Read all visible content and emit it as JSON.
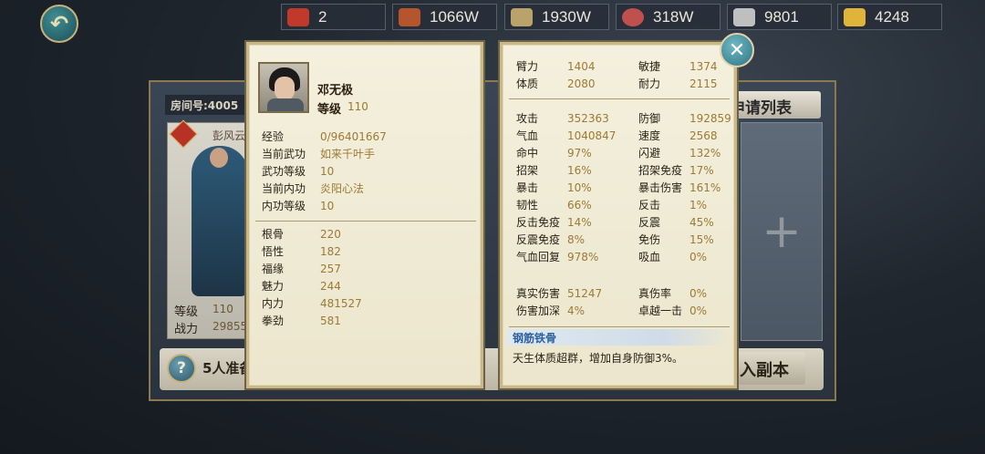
{
  "top_bar": {
    "back_icon": "back-arrow-icon",
    "resources": [
      {
        "icon": "token-icon",
        "value": "2",
        "color": "#c0392b"
      },
      {
        "icon": "wood-icon",
        "value": "1066W",
        "color": "#b5552e"
      },
      {
        "icon": "cloth-icon",
        "value": "1930W",
        "color": "#b9a36a"
      },
      {
        "icon": "ore-icon",
        "value": "318W",
        "color": "#c0504d"
      },
      {
        "icon": "silver-icon",
        "value": "9801",
        "color": "#bfbfbf"
      },
      {
        "icon": "gold-ingot-icon",
        "value": "4248",
        "color": "#e0b43a"
      }
    ]
  },
  "room": {
    "room_number": "房间号:4005",
    "apply_list": "申请列表",
    "player_name": "彭风云",
    "level_label": "等级",
    "level_value": "110",
    "power_label": "战力",
    "power_value": "29855",
    "ready_text": "5人准备",
    "enter_button": "入副本",
    "add_icon": "+"
  },
  "hero": {
    "name": "邓无极",
    "level_label": "等级",
    "level": "110",
    "info": [
      {
        "label": "经验",
        "value": "0/96401667"
      },
      {
        "label": "当前武功",
        "value": "如来千叶手"
      },
      {
        "label": "武功等级",
        "value": "10"
      },
      {
        "label": "当前内功",
        "value": "炎阳心法"
      },
      {
        "label": "内功等级",
        "value": "10"
      }
    ],
    "attrs": [
      {
        "label": "根骨",
        "value": "220"
      },
      {
        "label": "悟性",
        "value": "182"
      },
      {
        "label": "福缘",
        "value": "257"
      },
      {
        "label": "魅力",
        "value": "244"
      },
      {
        "label": "内力",
        "value": "481527"
      },
      {
        "label": "拳劲",
        "value": "581"
      }
    ]
  },
  "stats": {
    "base": [
      {
        "l1": "臂力",
        "v1": "1404",
        "l2": "敏捷",
        "v2": "1374"
      },
      {
        "l1": "体质",
        "v1": "2080",
        "l2": "耐力",
        "v2": "2115"
      }
    ],
    "combat": [
      {
        "l1": "攻击",
        "v1": "352363",
        "l2": "防御",
        "v2": "192859"
      },
      {
        "l1": "气血",
        "v1": "1040847",
        "l2": "速度",
        "v2": "2568"
      },
      {
        "l1": "命中",
        "v1": "97%",
        "l2": "闪避",
        "v2": "132%"
      },
      {
        "l1": "招架",
        "v1": "16%",
        "l2": "招架免疫",
        "v2": "17%"
      },
      {
        "l1": "暴击",
        "v1": "10%",
        "l2": "暴击伤害",
        "v2": "161%"
      },
      {
        "l1": "韧性",
        "v1": "66%",
        "l2": "反击",
        "v2": "1%"
      },
      {
        "l1": "反击免疫",
        "v1": "14%",
        "l2": "反震",
        "v2": "45%"
      },
      {
        "l1": "反震免疫",
        "v1": "8%",
        "l2": "免伤",
        "v2": "15%"
      },
      {
        "l1": "气血回复",
        "v1": "978%",
        "l2": "吸血",
        "v2": "0%"
      }
    ],
    "damage": [
      {
        "l1": "真实伤害",
        "v1": "51247",
        "l2": "真伤率",
        "v2": "0%"
      },
      {
        "l1": "伤害加深",
        "v1": "4%",
        "l2": "卓越一击",
        "v2": "0%"
      }
    ],
    "skill_name": "钢筋铁骨",
    "skill_desc": "天生体质超群，增加自身防御3%。"
  },
  "close_icon": "close-icon"
}
